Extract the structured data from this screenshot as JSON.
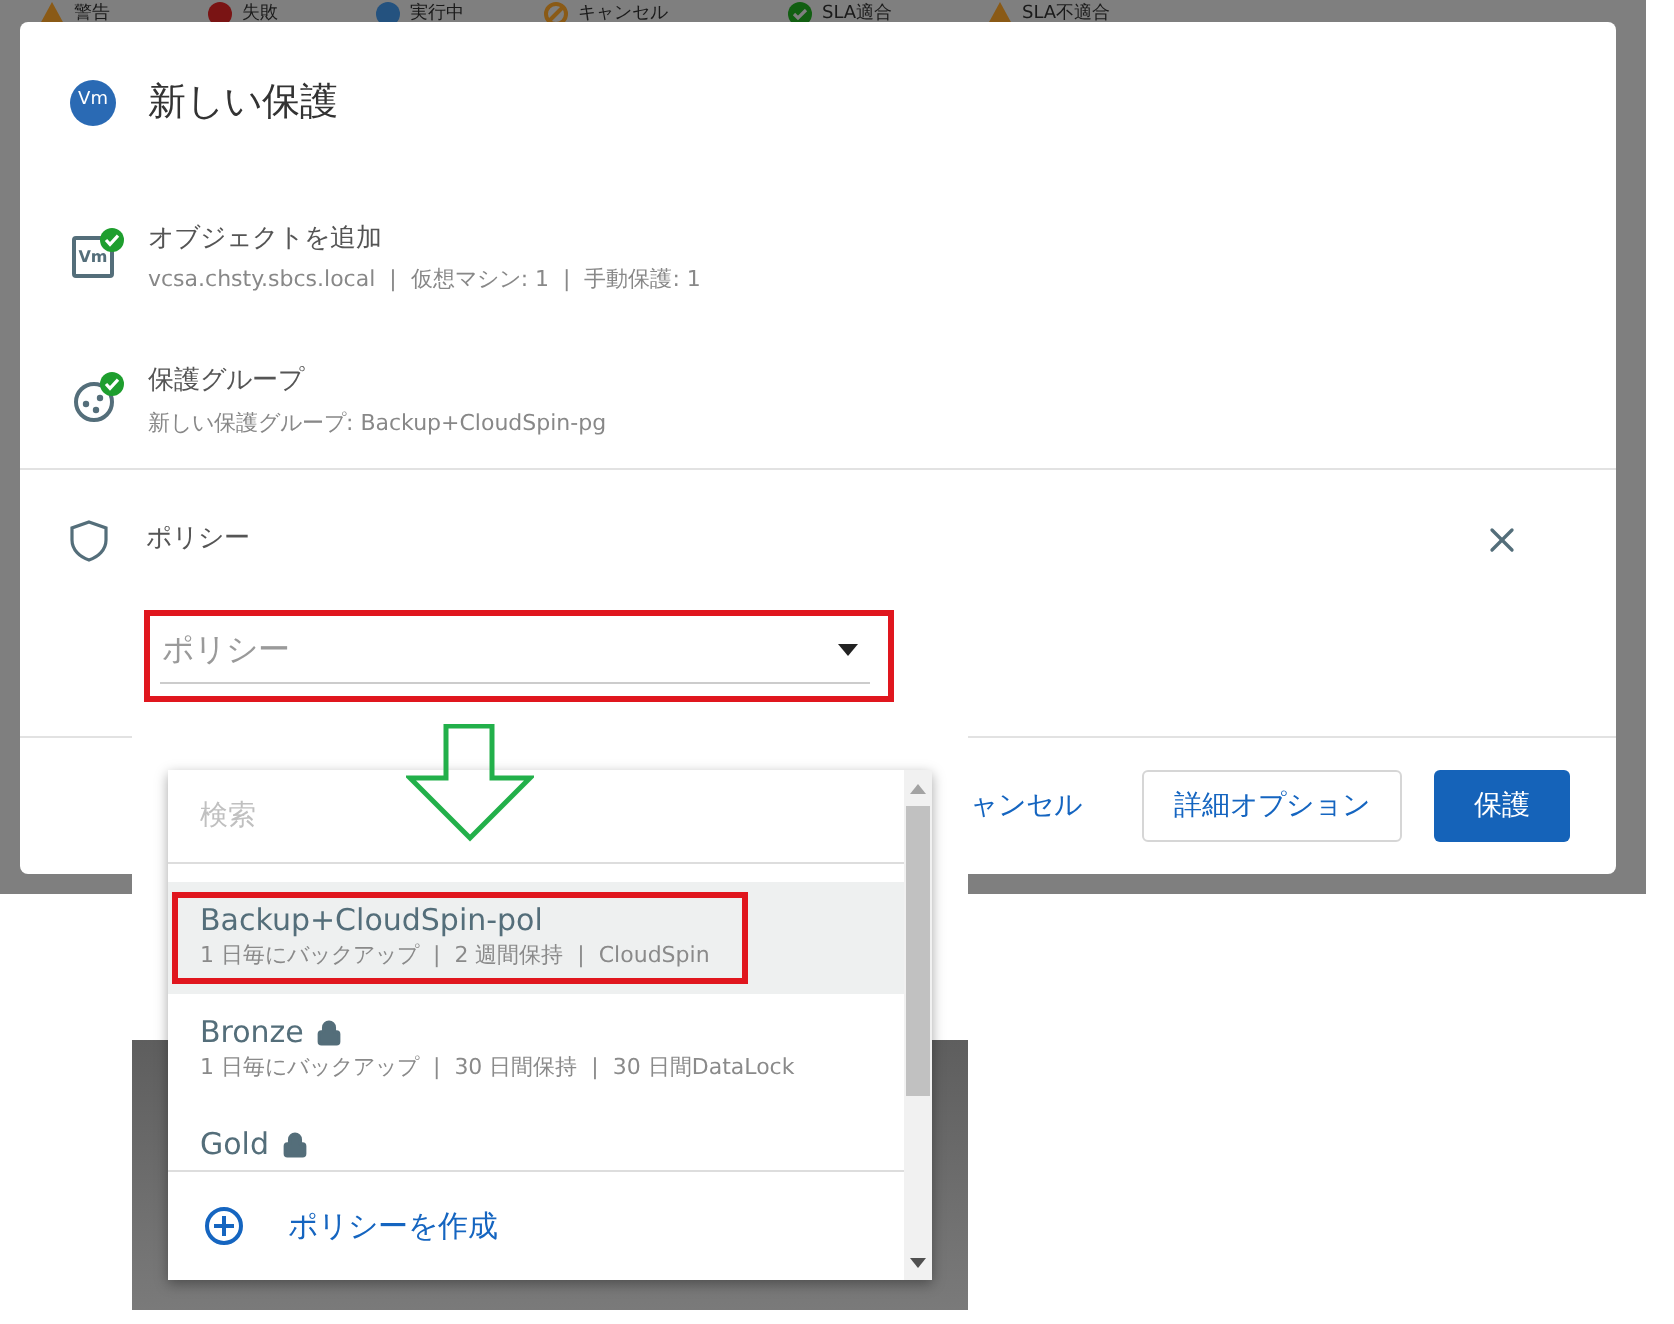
{
  "background_legend": [
    {
      "kind": "warning",
      "label": "警告"
    },
    {
      "kind": "failed",
      "label": "失敗"
    },
    {
      "kind": "running",
      "label": "実行中"
    },
    {
      "kind": "cancelled",
      "label": "キャンセル"
    },
    {
      "kind": "sla_met",
      "label": "SLA適合"
    },
    {
      "kind": "sla_missed",
      "label": "SLA不適合"
    }
  ],
  "dialog": {
    "badge": "Vm",
    "title": "新しい保護",
    "steps": [
      {
        "kind": "objects",
        "icon_text": "Vm",
        "done": true,
        "title": "オブジェクトを追加",
        "summary": "vcsa.chsty.sbcs.local  |  仮想マシン: 1  |  手動保護: 1"
      },
      {
        "kind": "group",
        "done": true,
        "title": "保護グループ",
        "summary": "新しい保護グループ: Backup+CloudSpin-pg"
      }
    ],
    "policy_step": {
      "title": "ポリシー",
      "select": {
        "placeholder": "ポリシー"
      }
    },
    "footer_buttons": [
      {
        "kind": "link",
        "label": "ャンセル"
      },
      {
        "kind": "outline",
        "label": "詳細オプション"
      },
      {
        "kind": "primary",
        "label": "保護"
      }
    ]
  },
  "dropdown": {
    "search": {
      "placeholder": "検索"
    },
    "options": [
      {
        "name": "Backup+CloudSpin-pol",
        "locked": false,
        "selected": true,
        "details": "1 日毎にバックアップ  |  2 週間保持  |  CloudSpin"
      },
      {
        "name": "Bronze",
        "locked": true,
        "selected": false,
        "details": "1 日毎にバックアップ  |  30 日間保持  |  30 日間DataLock"
      },
      {
        "name": "Gold",
        "locked": true,
        "selected": false
      }
    ],
    "create_label": "ポリシーを作成"
  }
}
